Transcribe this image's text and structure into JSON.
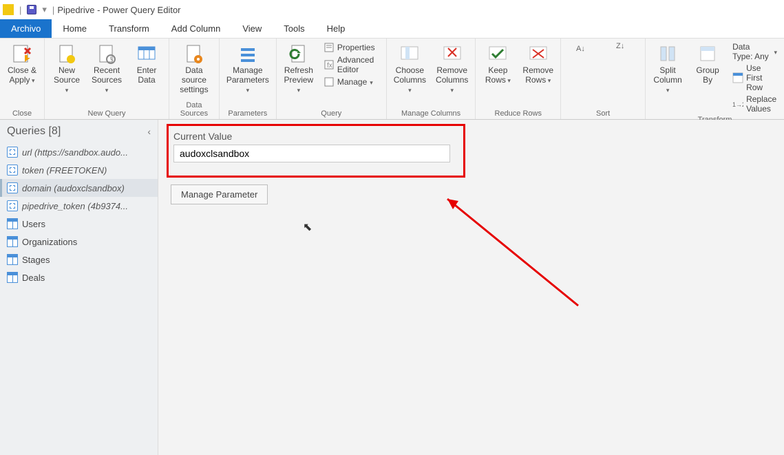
{
  "titlebar": {
    "doc": "Pipedrive",
    "app": "Power Query Editor"
  },
  "menu": {
    "archivo": "Archivo",
    "home": "Home",
    "transform": "Transform",
    "addcolumn": "Add Column",
    "view": "View",
    "tools": "Tools",
    "help": "Help"
  },
  "ribbon": {
    "close": {
      "closeapply": "Close &\nApply",
      "group": "Close"
    },
    "newquery": {
      "newsource": "New\nSource",
      "recentsources": "Recent\nSources",
      "enterdata": "Enter\nData",
      "group": "New Query"
    },
    "datasources": {
      "dss": "Data source\nsettings",
      "group": "Data Sources"
    },
    "parameters": {
      "mp": "Manage\nParameters",
      "group": "Parameters"
    },
    "query": {
      "refresh": "Refresh\nPreview",
      "properties": "Properties",
      "advanced": "Advanced Editor",
      "manage": "Manage",
      "group": "Query"
    },
    "managecolumns": {
      "choose": "Choose\nColumns",
      "remove": "Remove\nColumns",
      "group": "Manage Columns"
    },
    "reducerows": {
      "keep": "Keep\nRows",
      "remove": "Remove\nRows",
      "group": "Reduce Rows"
    },
    "sort": {
      "group": "Sort"
    },
    "transform": {
      "split": "Split\nColumn",
      "group": "Group\nBy",
      "datatype": "Data Type: Any",
      "firstrow": "Use First Row",
      "replace": "Replace Values",
      "grouplabel": "Transform"
    }
  },
  "sidebar": {
    "title": "Queries [8]",
    "items": [
      {
        "label": "url (https://sandbox.audo...",
        "type": "param"
      },
      {
        "label": "token (FREETOKEN)",
        "type": "param"
      },
      {
        "label": "domain (audoxclsandbox)",
        "type": "param",
        "selected": true
      },
      {
        "label": "pipedrive_token (4b9374...",
        "type": "param"
      },
      {
        "label": "Users",
        "type": "table"
      },
      {
        "label": "Organizations",
        "type": "table"
      },
      {
        "label": "Stages",
        "type": "table"
      },
      {
        "label": "Deals",
        "type": "table"
      }
    ]
  },
  "main": {
    "fieldlabel": "Current Value",
    "value": "audoxclsandbox",
    "managebtn": "Manage Parameter"
  }
}
